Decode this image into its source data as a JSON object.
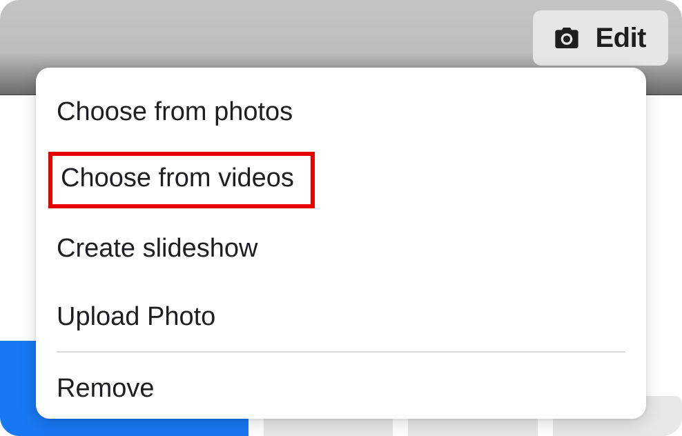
{
  "edit": {
    "label": "Edit",
    "icon_name": "camera-icon"
  },
  "menu": {
    "items": [
      {
        "label": "Choose from photos",
        "highlighted": false
      },
      {
        "label": "Choose from videos",
        "highlighted": true
      },
      {
        "label": "Create slideshow",
        "highlighted": false
      },
      {
        "label": "Upload Photo",
        "highlighted": false
      }
    ],
    "remove_label": "Remove"
  },
  "colors": {
    "highlight_outline": "#e60000",
    "primary_blue": "#1877f2",
    "edit_button_bg": "#e4e6ea",
    "text": "#1c1e21"
  }
}
